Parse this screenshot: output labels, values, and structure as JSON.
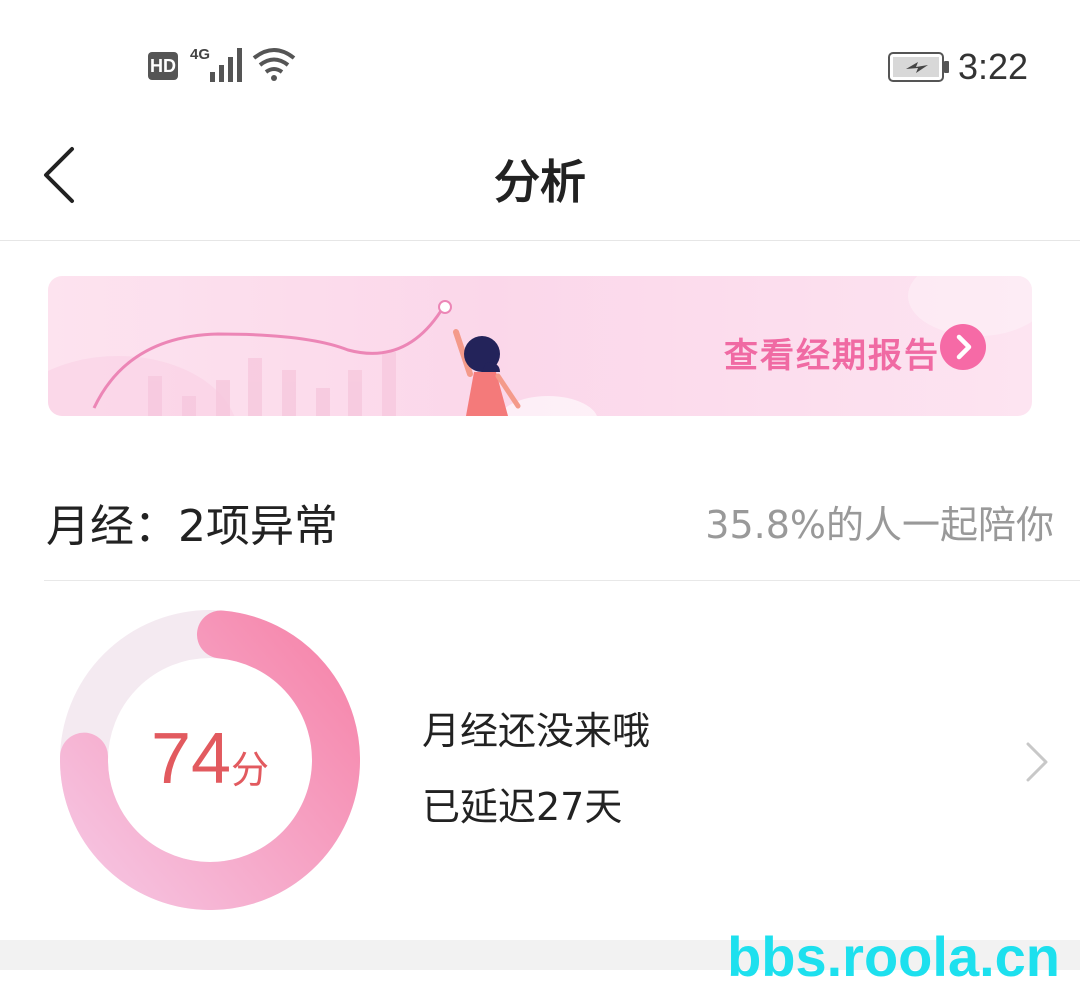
{
  "status_bar": {
    "hd": "HD",
    "network": "4G",
    "time": "3:22"
  },
  "header": {
    "title": "分析"
  },
  "banner": {
    "label": "查看经期报告"
  },
  "summary": {
    "title": "月经：2项异常",
    "companion": "35.8%的人一起陪你"
  },
  "score": {
    "value": "74",
    "unit": "分"
  },
  "period_status": {
    "line1": "月经还没来哦",
    "line2": "已延迟27天"
  },
  "watermark": "bbs.roola.cn",
  "colors": {
    "accent": "#f66aa6",
    "score": "#e25a5f"
  },
  "icons": {
    "back": "chevron-left-icon",
    "detail": "chevron-right-icon",
    "banner_arrow": "circle-arrow-right-icon"
  }
}
